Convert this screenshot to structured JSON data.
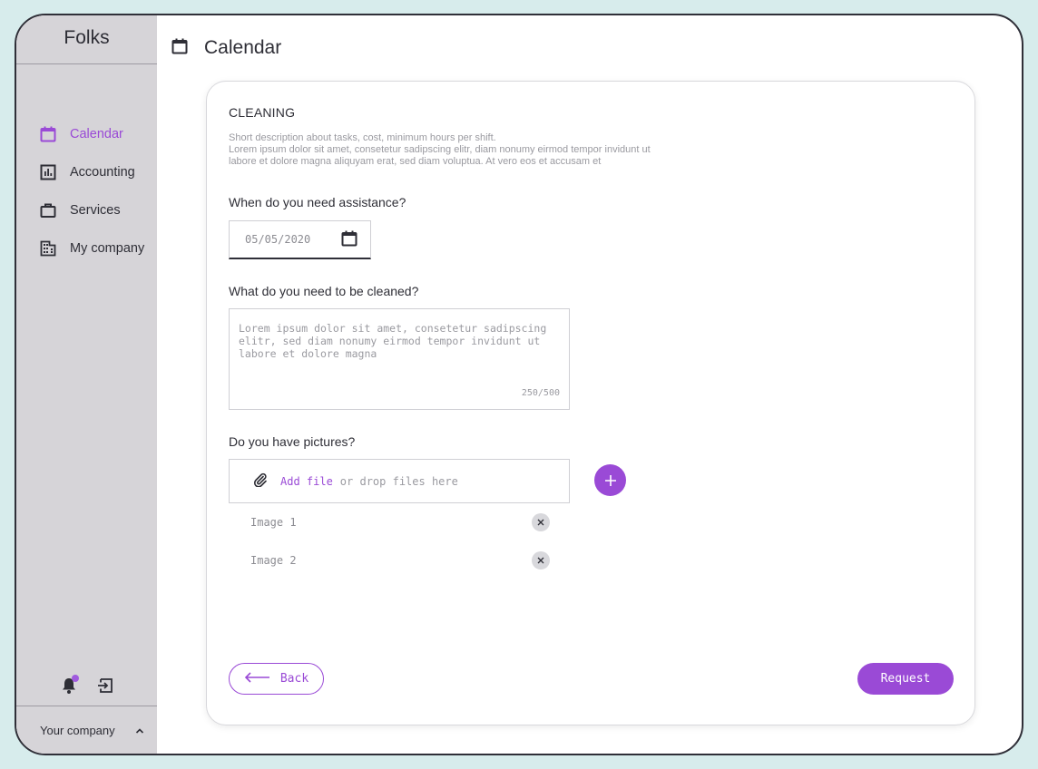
{
  "app": {
    "brand": "Folks"
  },
  "sidebar": {
    "items": [
      {
        "label": "Calendar",
        "icon": "calendar-icon",
        "active": true
      },
      {
        "label": "Accounting",
        "icon": "chart-icon",
        "active": false
      },
      {
        "label": "Services",
        "icon": "briefcase-icon",
        "active": false
      },
      {
        "label": "My company",
        "icon": "building-icon",
        "active": false
      }
    ],
    "company_switcher": {
      "label": "Your company"
    }
  },
  "header": {
    "title": "Calendar",
    "icon": "calendar-icon"
  },
  "form": {
    "section_title": "CLEANING",
    "description": [
      "Short description about tasks, cost, minimum hours per shift.",
      "Lorem ipsum dolor sit amet, consetetur sadipscing elitr, diam nonumy eirmod tempor invidunt ut",
      "labore et dolore magna aliquyam erat, sed diam voluptua. At vero eos et accusam et"
    ],
    "date_question": "When do you need assistance?",
    "date_value": "05/05/2020",
    "clean_question": "What do you need to be cleaned?",
    "clean_text": "Lorem ipsum dolor sit amet, consetetur sadipscing elitr, sed diam nonumy eirmod tempor invidunt ut labore et dolore magna",
    "char_counter": "250/500",
    "pictures_question": "Do you have pictures?",
    "upload_link": "Add file",
    "upload_hint": "or drop files here",
    "files": [
      "Image 1",
      "Image 2"
    ],
    "back_label": "Back",
    "request_label": "Request"
  },
  "colors": {
    "accent": "#9a4ad6",
    "sidebar_bg": "#d6d4d8",
    "page_bg": "#d7ecec"
  }
}
